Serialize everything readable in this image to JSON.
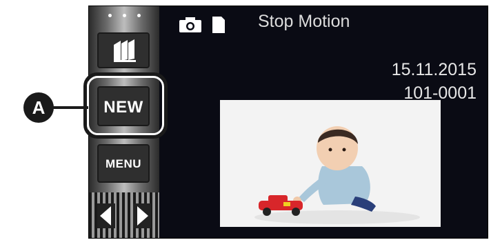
{
  "screen": {
    "title": "Stop Motion",
    "date": "15.11.2015",
    "file_number": "101-0001",
    "status_icons": [
      "camera-icon",
      "card-icon"
    ]
  },
  "sidebar": {
    "mode_button_icon": "flip-book-icon",
    "new_button_label": "NEW",
    "menu_button_label": "MENU",
    "nav_icons": [
      "arrow-left-icon",
      "arrow-right-icon"
    ]
  },
  "annotation": {
    "label": "A"
  },
  "photo": {
    "subject": "baby-with-toy-car-image"
  },
  "colors": {
    "screen_background": "#0a0b14",
    "text": "#e6e6e6",
    "button": "#2f2f2f"
  }
}
